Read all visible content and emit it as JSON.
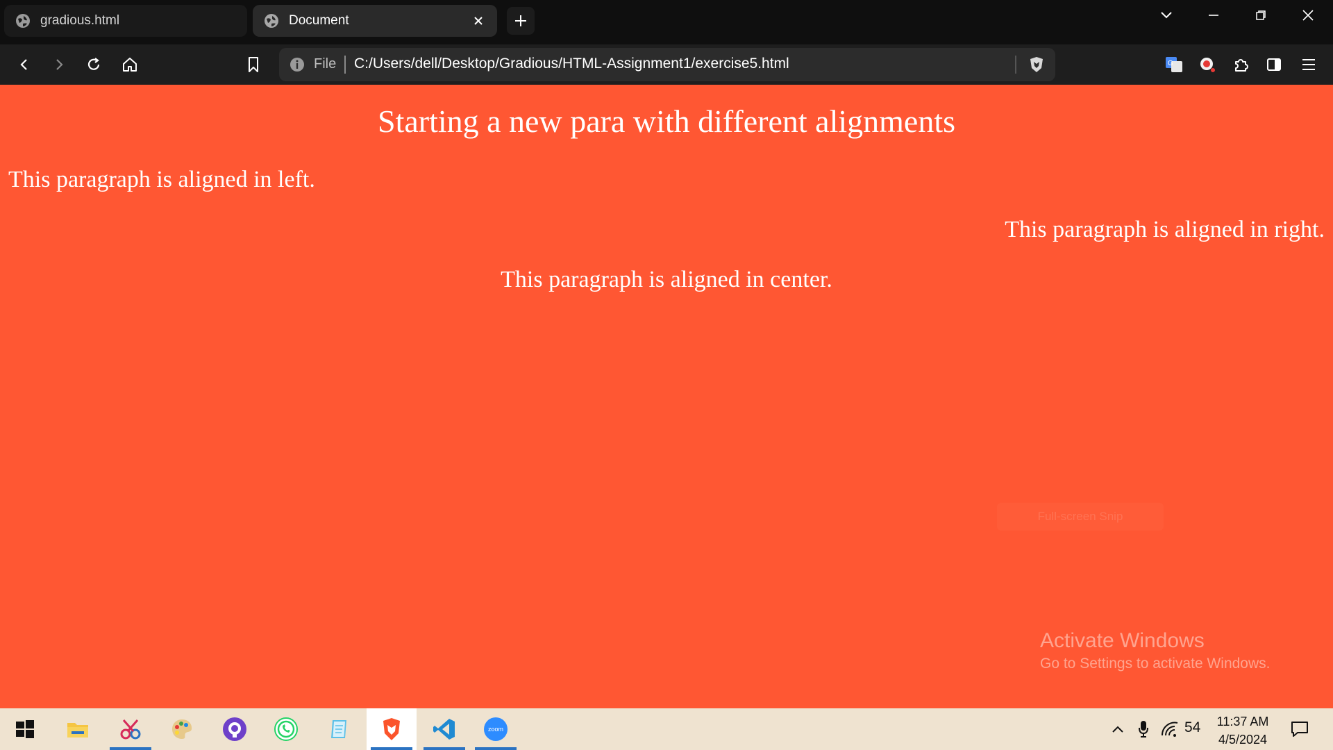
{
  "browser": {
    "tabs": [
      {
        "label": "gradious.html",
        "active": false
      },
      {
        "label": "Document",
        "active": true
      }
    ],
    "address": {
      "scheme_label": "File",
      "url": "C:/Users/dell/Desktop/Gradious/HTML-Assignment1/exercise5.html"
    }
  },
  "page": {
    "heading": "Starting a new para with different alignments",
    "para_left": "This paragraph is aligned in left.",
    "para_right": "This paragraph is aligned in right.",
    "para_center": "This paragraph is aligned in center.",
    "background_color": "#ff5733",
    "ghost_button": "Full-screen Snip"
  },
  "watermark": {
    "title": "Activate Windows",
    "subtitle": "Go to Settings to activate Windows."
  },
  "taskbar": {
    "apps": [
      "windows-start",
      "file-explorer",
      "snipping-tool",
      "paint",
      "github-desktop",
      "whatsapp",
      "notepad",
      "brave-browser",
      "vscode",
      "zoom"
    ],
    "zoom_label": "zoom",
    "battery": "54",
    "time": "11:37 AM",
    "date": "4/5/2024"
  }
}
